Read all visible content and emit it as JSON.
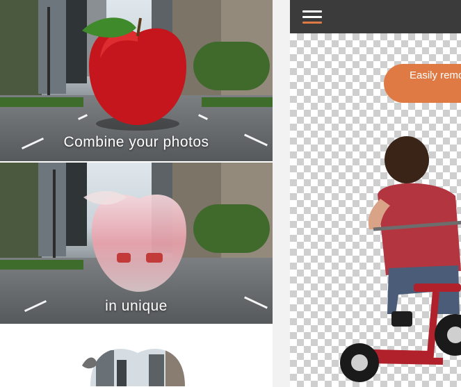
{
  "left_panel": {
    "slides": [
      {
        "caption": "Combine your photos"
      },
      {
        "caption": "in unique"
      }
    ]
  },
  "right_panel": {
    "menu_icon": "hamburger-menu-icon",
    "banner_text": "Easily remo",
    "colors": {
      "topbar": "#3b3b3b",
      "accent": "#e07a45",
      "menu_lines": "#ffffff"
    }
  }
}
